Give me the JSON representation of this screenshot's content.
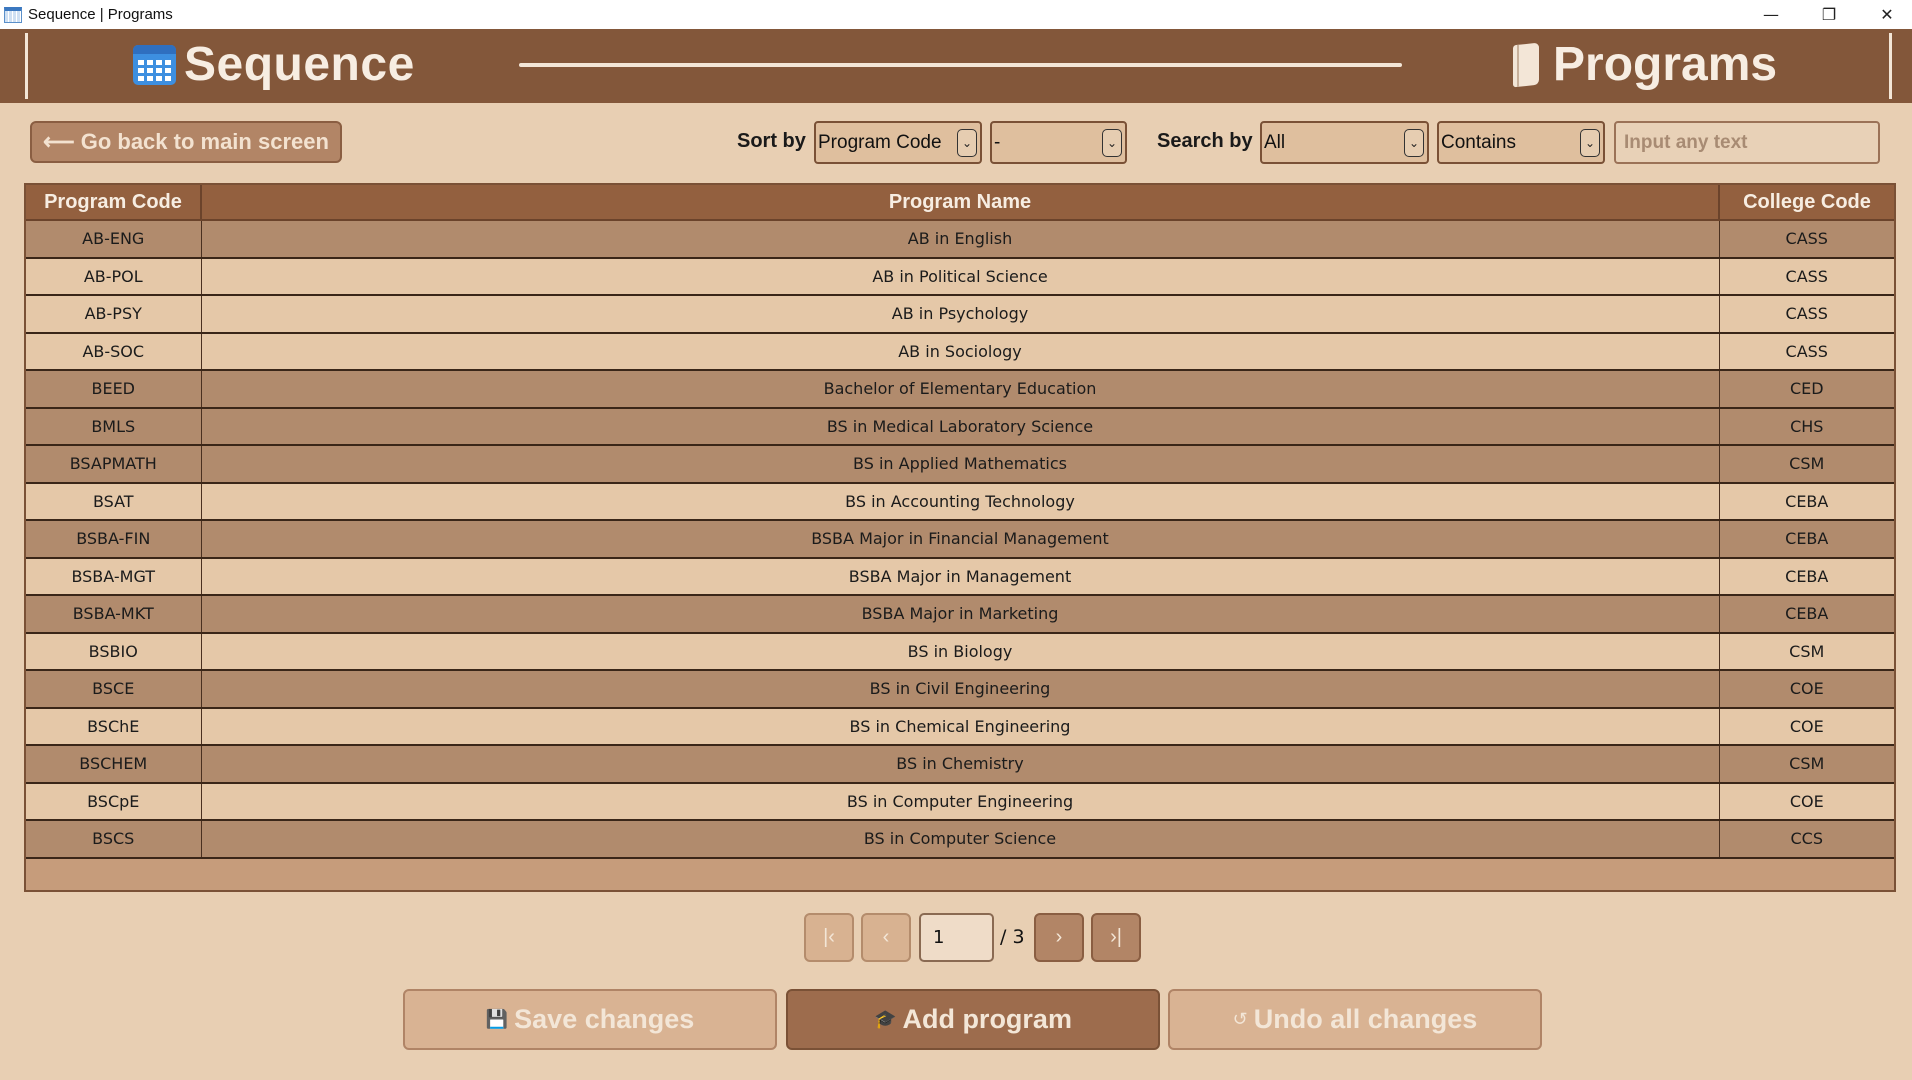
{
  "window": {
    "title": "Sequence | Programs",
    "minimize_icon": "—",
    "restore_icon": "❐",
    "close_icon": "✕"
  },
  "header": {
    "app_name": "Sequence",
    "section_title": "Programs"
  },
  "toolbar": {
    "back_label": "⟵ Go back to main screen",
    "sort_label": "Sort by",
    "sort_field": "Program Code",
    "sort_order": "-",
    "search_label": "Search by",
    "search_field": "All",
    "search_mode": "Contains",
    "search_placeholder": "Input any text"
  },
  "table": {
    "columns": [
      "Program Code",
      "Program Name",
      "College Code"
    ],
    "rows": [
      [
        "AB-ENG",
        "AB in English",
        "CASS"
      ],
      [
        "AB-POL",
        "AB in Political Science",
        "CASS"
      ],
      [
        "AB-PSY",
        "AB in Psychology",
        "CASS"
      ],
      [
        "AB-SOC",
        "AB in Sociology",
        "CASS"
      ],
      [
        "BEED",
        "Bachelor of Elementary Education",
        "CED"
      ],
      [
        "BMLS",
        "BS in Medical Laboratory Science",
        "CHS"
      ],
      [
        "BSAPMATH",
        "BS in Applied Mathematics",
        "CSM"
      ],
      [
        "BSAT",
        "BS in Accounting Technology",
        "CEBA"
      ],
      [
        "BSBA-FIN",
        "BSBA Major in Financial Management",
        "CEBA"
      ],
      [
        "BSBA-MGT",
        "BSBA Major in Management",
        "CEBA"
      ],
      [
        "BSBA-MKT",
        "BSBA Major in Marketing",
        "CEBA"
      ],
      [
        "BSBIO",
        "BS in Biology",
        "CSM"
      ],
      [
        "BSCE",
        "BS in Civil Engineering",
        "COE"
      ],
      [
        "BSChE",
        "BS in Chemical Engineering",
        "COE"
      ],
      [
        "BSCHEM",
        "BS in Chemistry",
        "CSM"
      ],
      [
        "BSCpE",
        "BS in Computer Engineering",
        "COE"
      ],
      [
        "BSCS",
        "BS in Computer Science",
        "CCS"
      ]
    ]
  },
  "pagination": {
    "first_icon": "|‹",
    "prev_icon": "‹",
    "next_icon": "›",
    "last_icon": "›|",
    "current_page": "1",
    "total_label": "/ 3"
  },
  "actions": {
    "save_label": "Save changes",
    "add_label": "Add program",
    "undo_label": "Undo all changes"
  },
  "colors": {
    "header_bg": "#83573a",
    "body_bg": "#e8cfb3",
    "row_dark": "#b18b6d",
    "row_light": "#e5c8a8"
  }
}
